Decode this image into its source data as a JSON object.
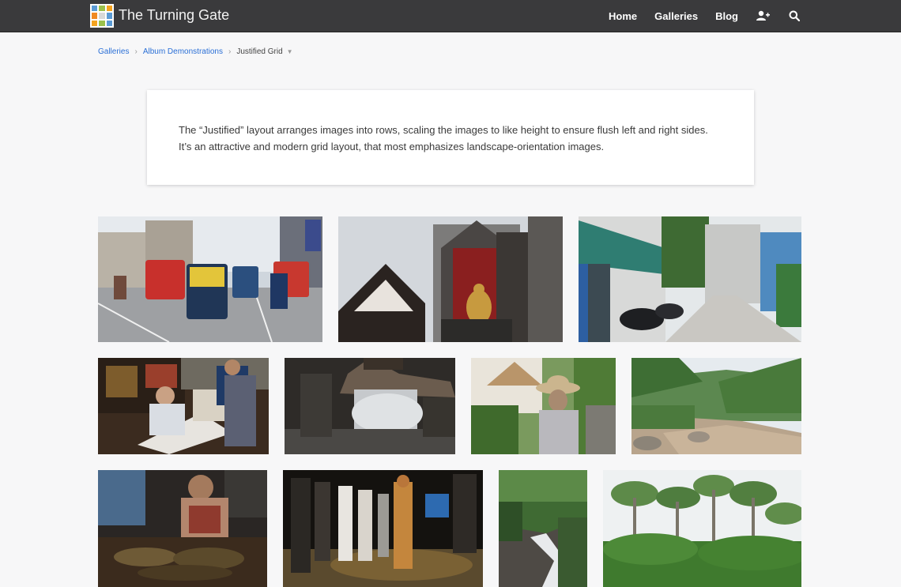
{
  "header": {
    "site_title": "The Turning Gate",
    "logo_colors": [
      "#5b9bd5",
      "#9bc14b",
      "#f4a31f",
      "#f08a24",
      "#d9d9d9",
      "#5b9bd5",
      "#f4a31f",
      "#9bc14b",
      "#5b9bd5"
    ],
    "nav": [
      {
        "label": "Home"
      },
      {
        "label": "Galleries"
      },
      {
        "label": "Blog"
      }
    ],
    "icons": [
      "add-user-icon",
      "search-icon"
    ]
  },
  "breadcrumb": {
    "items": [
      {
        "label": "Galleries"
      },
      {
        "label": "Album Demonstrations"
      }
    ],
    "current": "Justified Grid"
  },
  "description": {
    "text": "The “Justified” layout arranges images into rows, scaling the images to like height to ensure flush left and right sides. It’s an attractive and modern grid layout, that most emphasizes landscape-orientation images."
  },
  "gallery": {
    "photos": [
      {
        "subject": "tuk-tuks on city street"
      },
      {
        "subject": "temple buddha shrine"
      },
      {
        "subject": "alley with motorbikes"
      },
      {
        "subject": "newspaper stand"
      },
      {
        "subject": "reflection of temple roof"
      },
      {
        "subject": "old man with hat"
      },
      {
        "subject": "jungle river"
      },
      {
        "subject": "street food vendor"
      },
      {
        "subject": "night market dancer"
      },
      {
        "subject": "waterfall"
      },
      {
        "subject": "forest canopy"
      }
    ]
  }
}
